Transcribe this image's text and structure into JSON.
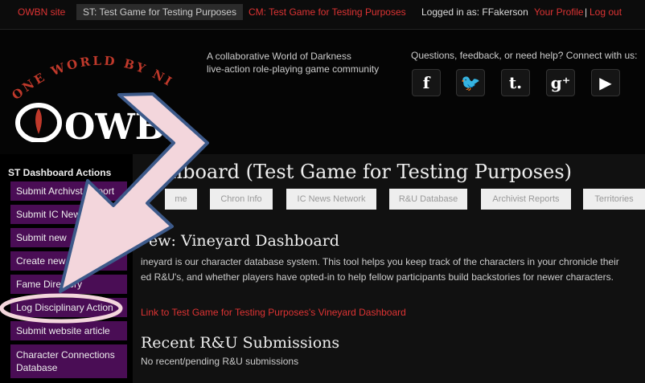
{
  "topbar": {
    "site_link": "OWBN site",
    "st_link": "ST: Test Game for Testing Purposes",
    "cm_link": "CM: Test Game for Testing Purposes",
    "logged_in": "Logged in as: FFakerson",
    "profile_link": "Your Profile",
    "separator": "|",
    "logout_link": "Log out"
  },
  "header": {
    "logo_arc_text": "ONE WORLD BY NIGHT",
    "logo_main_text": "OWBN",
    "tagline_line1": "A collaborative World of Darkness",
    "tagline_line2": "live-action role-playing game community",
    "connect_text": "Questions, feedback, or need help? Connect with us:",
    "social": [
      {
        "icon": "facebook-icon",
        "glyph": "f"
      },
      {
        "icon": "twitter-icon",
        "glyph": "🐦"
      },
      {
        "icon": "tumblr-icon",
        "glyph": "t."
      },
      {
        "icon": "google-plus-icon",
        "glyph": "g⁺"
      },
      {
        "icon": "youtube-icon",
        "glyph": "▶"
      }
    ]
  },
  "sidebar": {
    "title": "ST Dashboard Actions",
    "items": [
      "Submit Archivst Report",
      "Submit IC News Rep",
      "Submit new",
      "Create new Fa",
      "Fame Directory",
      "Log Disciplinary Action",
      "Submit website article",
      "Character Connections Database"
    ]
  },
  "main": {
    "title": "ashboard (Test Game for Testing Purposes)",
    "tabs": [
      "me",
      "Chron Info",
      "IC News Network",
      "R&U Database",
      "Archivist Reports",
      "Territories"
    ],
    "vineyard_heading": "ew: Vineyard Dashboard",
    "vineyard_para": "ineyard is our character database system. This tool helps you keep track of the characters in your chronicle their ed R&U's, and whether players have opted-in to help fellow participants build backstories for newer characters.",
    "vineyard_link": "Link to Test Game for Testing Purposes's Vineyard Dashboard",
    "recent_heading": "Recent R&U Submissions",
    "recent_empty": "No recent/pending R&U submissions"
  },
  "colors": {
    "accent_red": "#dd3333",
    "sidebar_purple": "#4a0d55",
    "arrow_fill": "#f3d6dc",
    "arrow_stroke": "#3d5a8a"
  }
}
